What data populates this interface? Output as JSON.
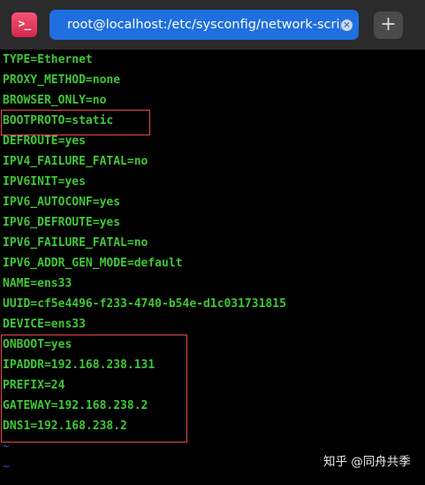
{
  "app": {
    "icon_glyph": ">_"
  },
  "tab": {
    "title": "root@localhost:/etc/sysconfig/network-scripts",
    "close_glyph": "×"
  },
  "new_tab_glyph": "+",
  "terminal": {
    "lines": [
      "TYPE=Ethernet",
      "PROXY_METHOD=none",
      "BROWSER_ONLY=no",
      "BOOTPROTO=static",
      "DEFROUTE=yes",
      "IPV4_FAILURE_FATAL=no",
      "IPV6INIT=yes",
      "IPV6_AUTOCONF=yes",
      "IPV6_DEFROUTE=yes",
      "IPV6_FAILURE_FATAL=no",
      "IPV6_ADDR_GEN_MODE=default",
      "NAME=ens33",
      "UUID=cf5e4496-f233-4740-b54e-d1c031731815",
      "DEVICE=ens33",
      "ONBOOT=yes",
      "IPADDR=192.168.238.131",
      "PREFIX=24",
      "GATEWAY=192.168.238.2",
      "DNS1=192.168.238.2"
    ],
    "tildes": [
      "~",
      "~"
    ]
  },
  "watermark": "知乎 @同舟共季",
  "colors": {
    "text": "#3ec736",
    "highlight": "#e5484d",
    "tab": "#1f6fe0",
    "titlebar": "#2b2b2b",
    "tilde": "#3050c8"
  }
}
